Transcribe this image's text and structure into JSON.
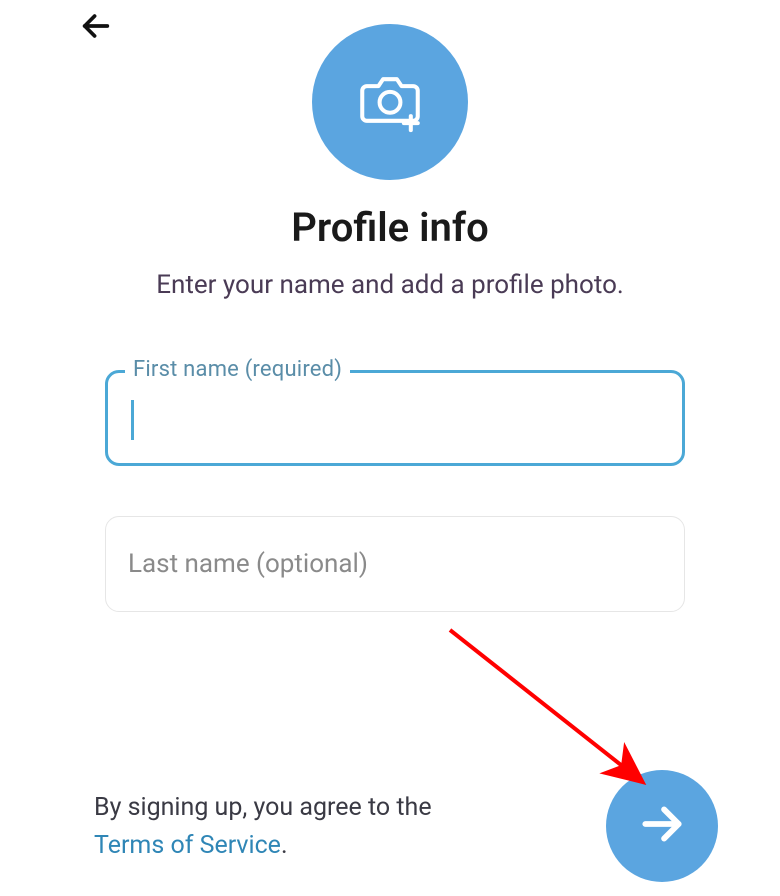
{
  "colors": {
    "accent": "#5ba5e0",
    "field_border_focus": "#4ba8d6",
    "link": "#2f86b6",
    "annotation": "#ff0000"
  },
  "icons": {
    "back": "arrow-left",
    "avatar": "camera-add",
    "next": "arrow-right"
  },
  "header": {
    "title": "Profile info",
    "subtitle": "Enter your name and add a profile photo."
  },
  "form": {
    "first_name": {
      "label": "First name (required)",
      "value": "",
      "placeholder": ""
    },
    "last_name": {
      "placeholder": "Last name (optional)",
      "value": ""
    }
  },
  "tos": {
    "prefix": "By signing up, you agree to the ",
    "link_text": "Terms of Service",
    "suffix": "."
  }
}
